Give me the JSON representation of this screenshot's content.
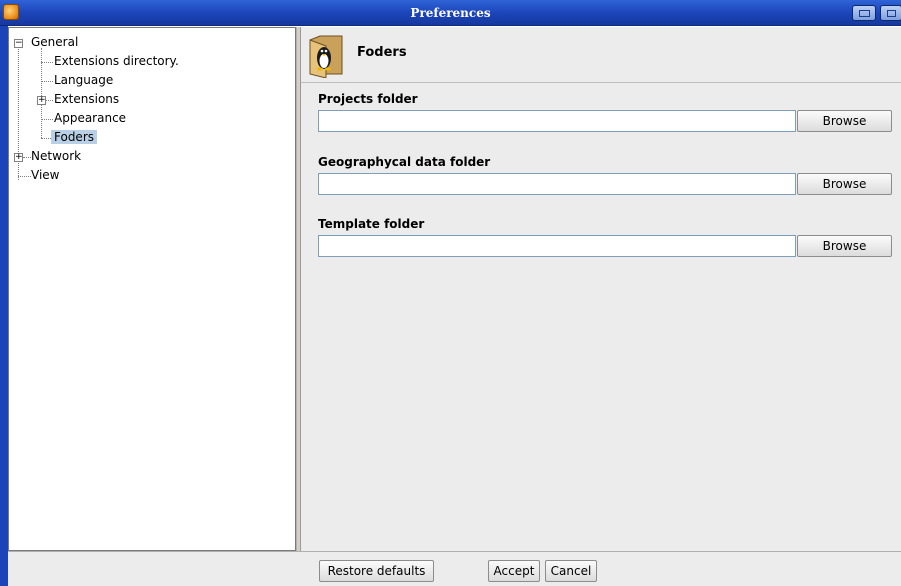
{
  "window": {
    "title": "Preferences"
  },
  "tree": {
    "items": [
      {
        "label": "General",
        "toggle": "−"
      },
      {
        "label": "Extensions directory."
      },
      {
        "label": "Language"
      },
      {
        "label": "Extensions",
        "toggle": "+"
      },
      {
        "label": "Appearance"
      },
      {
        "label": "Foders"
      },
      {
        "label": "Network",
        "toggle": "+"
      },
      {
        "label": "View"
      }
    ],
    "selected": "Foders"
  },
  "page": {
    "title": "Foders",
    "icon": "folder-penguin-icon",
    "fields": [
      {
        "label": "Projects folder",
        "value": "",
        "button": "Browse"
      },
      {
        "label": "Geographycal data folder",
        "value": "",
        "button": "Browse"
      },
      {
        "label": "Template folder",
        "value": "",
        "button": "Browse"
      }
    ]
  },
  "buttons": {
    "restore": "Restore defaults",
    "accept": "Accept",
    "cancel": "Cancel"
  },
  "colors": {
    "titlebar": "#1b44b8",
    "selection": "#b8cfe5",
    "panel": "#ececec"
  }
}
